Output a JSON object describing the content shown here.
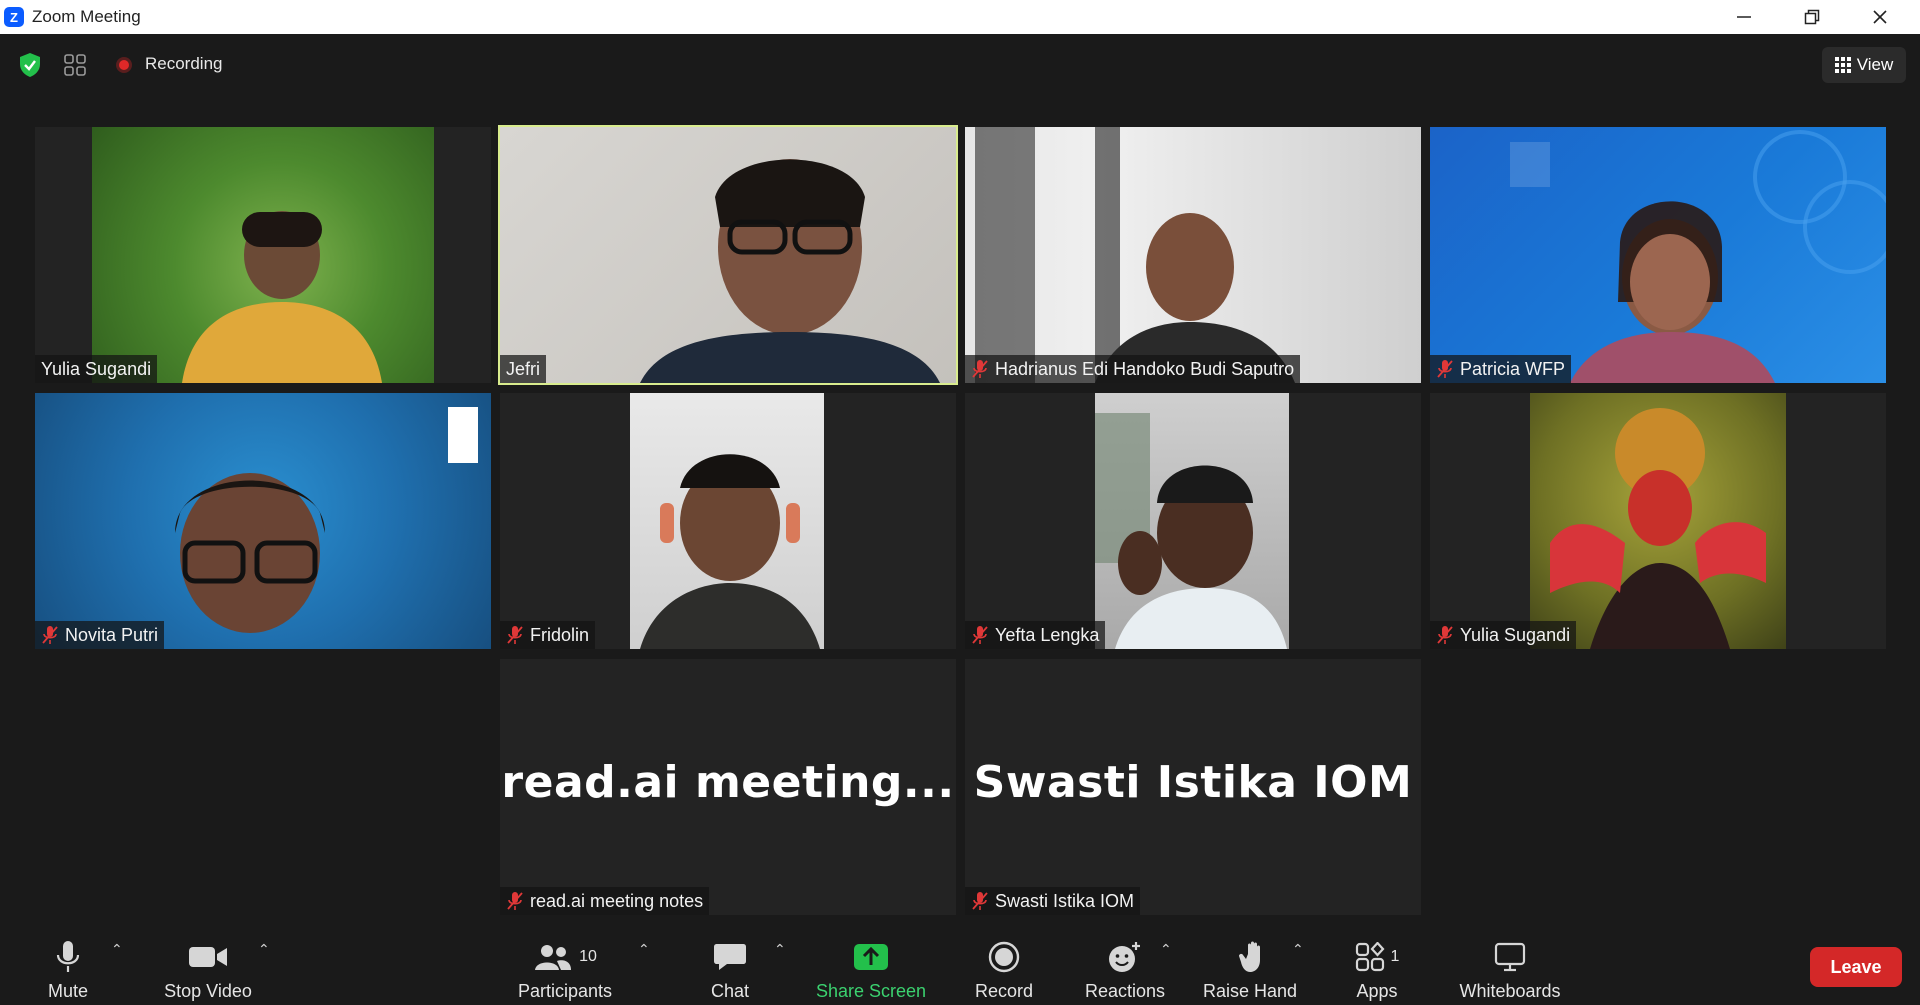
{
  "window": {
    "title": "Zoom Meeting",
    "app_icon": "zoom-logo",
    "controls": [
      "minimize",
      "restore",
      "close"
    ]
  },
  "topbar": {
    "recording_label": "Recording",
    "view_label": "View"
  },
  "tiles": [
    {
      "name": "Yulia Sugandi",
      "muted": false,
      "active": false
    },
    {
      "name": "Jefri",
      "muted": false,
      "active": true
    },
    {
      "name": "Hadrianus Edi Handoko Budi Saputro",
      "muted": true,
      "active": false
    },
    {
      "name": "Patricia WFP",
      "muted": true,
      "active": false
    },
    {
      "name": "Novita Putri",
      "muted": true,
      "active": false
    },
    {
      "name": "Fridolin",
      "muted": true,
      "active": false
    },
    {
      "name": "Yefta Lengka",
      "muted": true,
      "active": false
    },
    {
      "name": "Yulia Sugandi",
      "muted": true,
      "active": false
    },
    {
      "name": "read.ai meeting notes",
      "muted": true,
      "active": false,
      "display_text": "read.ai  meeting..."
    },
    {
      "name": "Swasti Istika IOM",
      "muted": true,
      "active": false,
      "display_text": "Swasti Istika IOM"
    }
  ],
  "toolbar": {
    "mute": "Mute",
    "stop_video": "Stop Video",
    "participants": "Participants",
    "participants_count": "10",
    "chat": "Chat",
    "share_screen": "Share Screen",
    "record": "Record",
    "reactions": "Reactions",
    "raise_hand": "Raise Hand",
    "apps": "Apps",
    "apps_count": "1",
    "whiteboards": "Whiteboards",
    "leave": "Leave"
  },
  "colors": {
    "accent_green": "#3bd16f",
    "leave_red": "#d42828",
    "active_border": "#d9ec8e",
    "zoom_blue": "#0b5cff"
  }
}
